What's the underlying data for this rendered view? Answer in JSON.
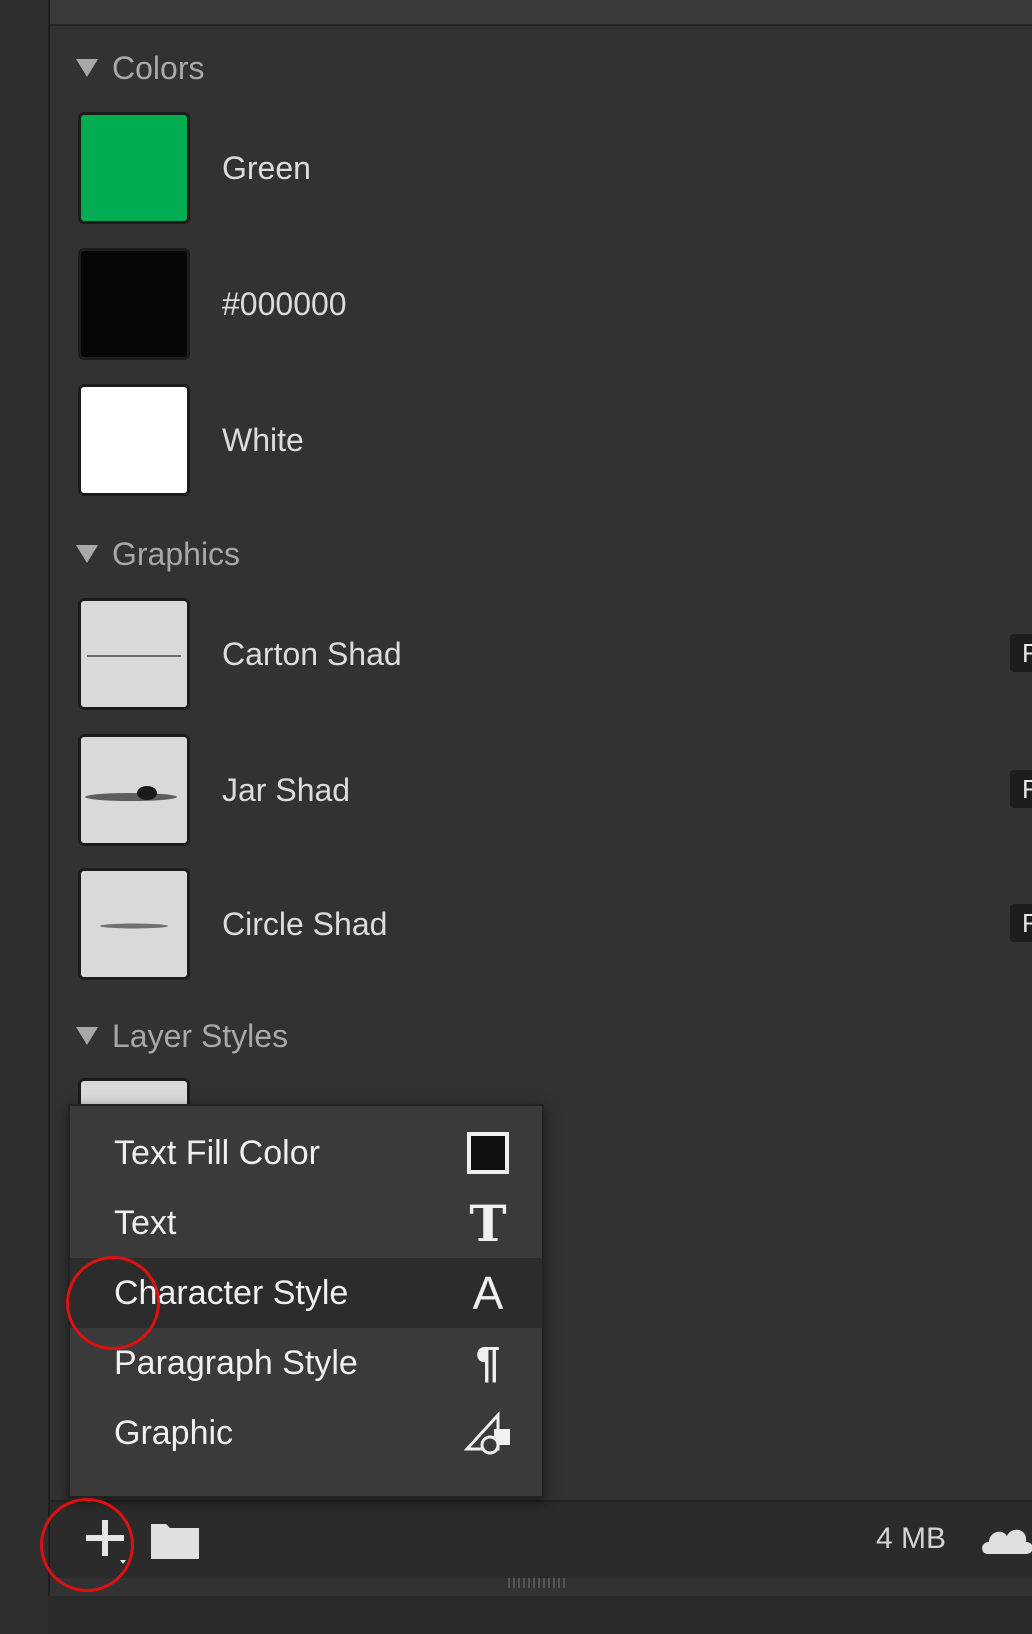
{
  "sections": {
    "colors": {
      "title": "Colors",
      "items": [
        {
          "label": "Green",
          "color": "#00ad51"
        },
        {
          "label": "#000000",
          "color": "#060606"
        },
        {
          "label": "White",
          "color": "#ffffff"
        }
      ]
    },
    "graphics": {
      "title": "Graphics",
      "items": [
        {
          "label": "Carton Shad",
          "tab": "F"
        },
        {
          "label": "Jar Shad",
          "tab": "F"
        },
        {
          "label": "Circle Shad",
          "tab": "F"
        }
      ]
    },
    "layer_styles": {
      "title": "Layer Styles"
    }
  },
  "menu": {
    "items": [
      {
        "label": "Text Fill Color",
        "icon": "square-outline-icon"
      },
      {
        "label": "Text",
        "icon": "text-T-icon",
        "glyph": "T"
      },
      {
        "label": "Character Style",
        "icon": "character-A-icon",
        "glyph": "A"
      },
      {
        "label": "Paragraph Style",
        "icon": "pilcrow-icon",
        "glyph": "¶"
      },
      {
        "label": "Graphic",
        "icon": "graphic-shapes-icon"
      }
    ]
  },
  "footer": {
    "size": "4 MB"
  },
  "annotation_color": "#e01010"
}
